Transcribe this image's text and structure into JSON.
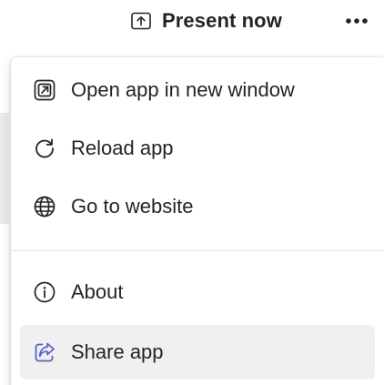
{
  "toolbar": {
    "present_label": "Present now",
    "present_icon": "share-screen-icon",
    "more_icon": "more-horizontal-icon"
  },
  "menu": {
    "items": [
      {
        "label": "Open app in new window",
        "icon": "open-new-window-icon"
      },
      {
        "label": "Reload app",
        "icon": "reload-icon"
      },
      {
        "label": "Go to website",
        "icon": "globe-icon"
      },
      {
        "label": "About",
        "icon": "info-icon"
      },
      {
        "label": "Share app",
        "icon": "share-icon",
        "highlighted": true
      }
    ]
  },
  "colors": {
    "text": "#242424",
    "accent": "#5b5fc7",
    "hover_bg": "#f0f0f0",
    "divider": "#e0e0e0"
  }
}
